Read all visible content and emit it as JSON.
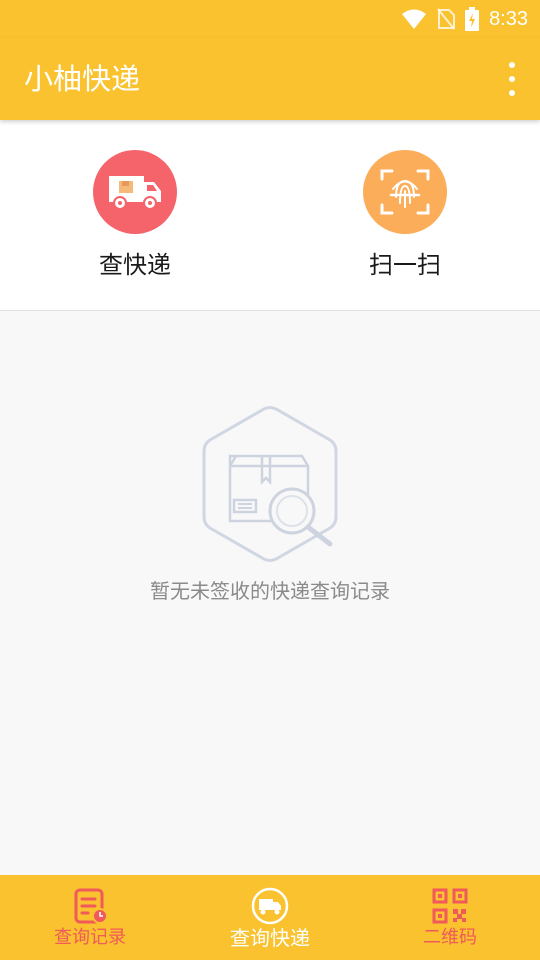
{
  "status_bar": {
    "time": "8:33",
    "icons": [
      "wifi-icon",
      "no-sim-icon",
      "battery-charging-icon"
    ]
  },
  "app_bar": {
    "title": "小柚快递",
    "menu_icon": "overflow-menu-icon"
  },
  "actions": [
    {
      "label": "查快递",
      "icon": "delivery-truck-icon",
      "color": "#f5636b"
    },
    {
      "label": "扫一扫",
      "icon": "fingerprint-scan-icon",
      "color": "#fbad5a"
    }
  ],
  "empty_state": {
    "icon": "package-search-icon",
    "message": "暂无未签收的快递查询记录"
  },
  "bottom_nav": [
    {
      "label": "查询记录",
      "icon": "records-icon",
      "active": false
    },
    {
      "label": "查询快递",
      "icon": "truck-circle-icon",
      "active": true
    },
    {
      "label": "二维码",
      "icon": "qr-code-icon",
      "active": false
    }
  ],
  "colors": {
    "brand_yellow": "#f9c22e",
    "accent_red": "#f05a5a",
    "accent_orange": "#fbad5a"
  }
}
